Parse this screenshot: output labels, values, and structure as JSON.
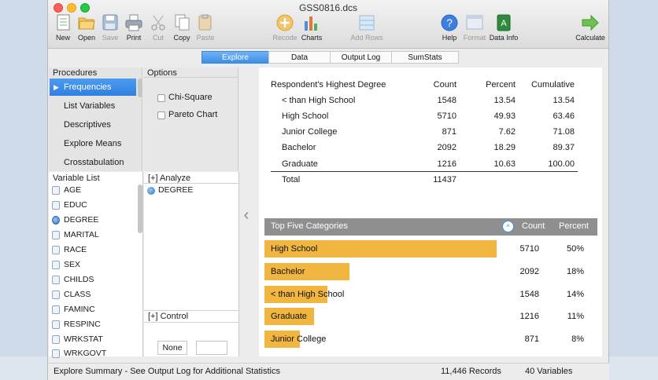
{
  "window": {
    "title": "GSS0816.dcs"
  },
  "toolbar": {
    "new": "New",
    "open": "Open",
    "save": "Save",
    "print": "Print",
    "cut": "Cut",
    "copy": "Copy",
    "paste": "Paste",
    "recode": "Recode",
    "charts": "Charts",
    "add_rows": "Add Rows",
    "help": "Help",
    "format": "Format",
    "data_info": "Data Info",
    "calculate": "Calculate",
    "help_glyph": "?",
    "data_info_glyph": "A"
  },
  "tabs": [
    {
      "label": "Explore",
      "active": true
    },
    {
      "label": "Data",
      "active": false
    },
    {
      "label": "Output Log",
      "active": false
    },
    {
      "label": "SumStats",
      "active": false
    }
  ],
  "procedures": {
    "header": "Procedures",
    "items": [
      "Frequencies",
      "List Variables",
      "Descriptives",
      "Explore Means",
      "Crosstabulation"
    ],
    "selected": "Frequencies"
  },
  "options": {
    "header": "Options",
    "items": [
      "Chi-Square",
      "Pareto Chart"
    ]
  },
  "variable_list": {
    "header": "Variable List",
    "items": [
      "AGE",
      "EDUC",
      "DEGREE",
      "MARITAL",
      "RACE",
      "SEX",
      "CHILDS",
      "CLASS",
      "FAMINC",
      "RESPINC",
      "WRKSTAT",
      "WRKGOVT"
    ]
  },
  "analyze": {
    "header": "[+] Analyze",
    "variable": "DEGREE",
    "control_header": "[+] Control",
    "none_button": "None"
  },
  "frequency_table": {
    "title": "Respondent's Highest Degree",
    "columns": [
      "Count",
      "Percent",
      "Cumulative"
    ],
    "rows": [
      {
        "label": "< than High School",
        "count": "1548",
        "percent": "13.54",
        "cumulative": "13.54"
      },
      {
        "label": "High School",
        "count": "5710",
        "percent": "49.93",
        "cumulative": "63.46"
      },
      {
        "label": "Junior College",
        "count": "871",
        "percent": "7.62",
        "cumulative": "71.08"
      },
      {
        "label": "Bachelor",
        "count": "2092",
        "percent": "18.29",
        "cumulative": "89.37"
      },
      {
        "label": "Graduate",
        "count": "1216",
        "percent": "10.63",
        "cumulative": "100.00"
      }
    ],
    "total_label": "Total",
    "total_count": "11437"
  },
  "top_five": {
    "title": "Top Five Categories",
    "col_count": "Count",
    "col_percent": "Percent",
    "collapse_glyph": "^",
    "items": [
      {
        "label": "High School",
        "count": "5710",
        "percent": "50%",
        "fraction": 0.4993
      },
      {
        "label": "Bachelor",
        "count": "2092",
        "percent": "18%",
        "fraction": 0.1829
      },
      {
        "label": "< than High School",
        "count": "1548",
        "percent": "14%",
        "fraction": 0.1354
      },
      {
        "label": "Graduate",
        "count": "1216",
        "percent": "11%",
        "fraction": 0.1063
      },
      {
        "label": "Junior College",
        "count": "871",
        "percent": "8%",
        "fraction": 0.0762
      }
    ]
  },
  "status": {
    "summary": "Explore Summary  -  See Output Log for Additional Statistics",
    "records": "11,446 Records",
    "variables": "40 Variables"
  },
  "colors": {
    "accent": "#3d8ee8",
    "bar": "#f0b63f",
    "header_gray": "#8f8f8f"
  }
}
